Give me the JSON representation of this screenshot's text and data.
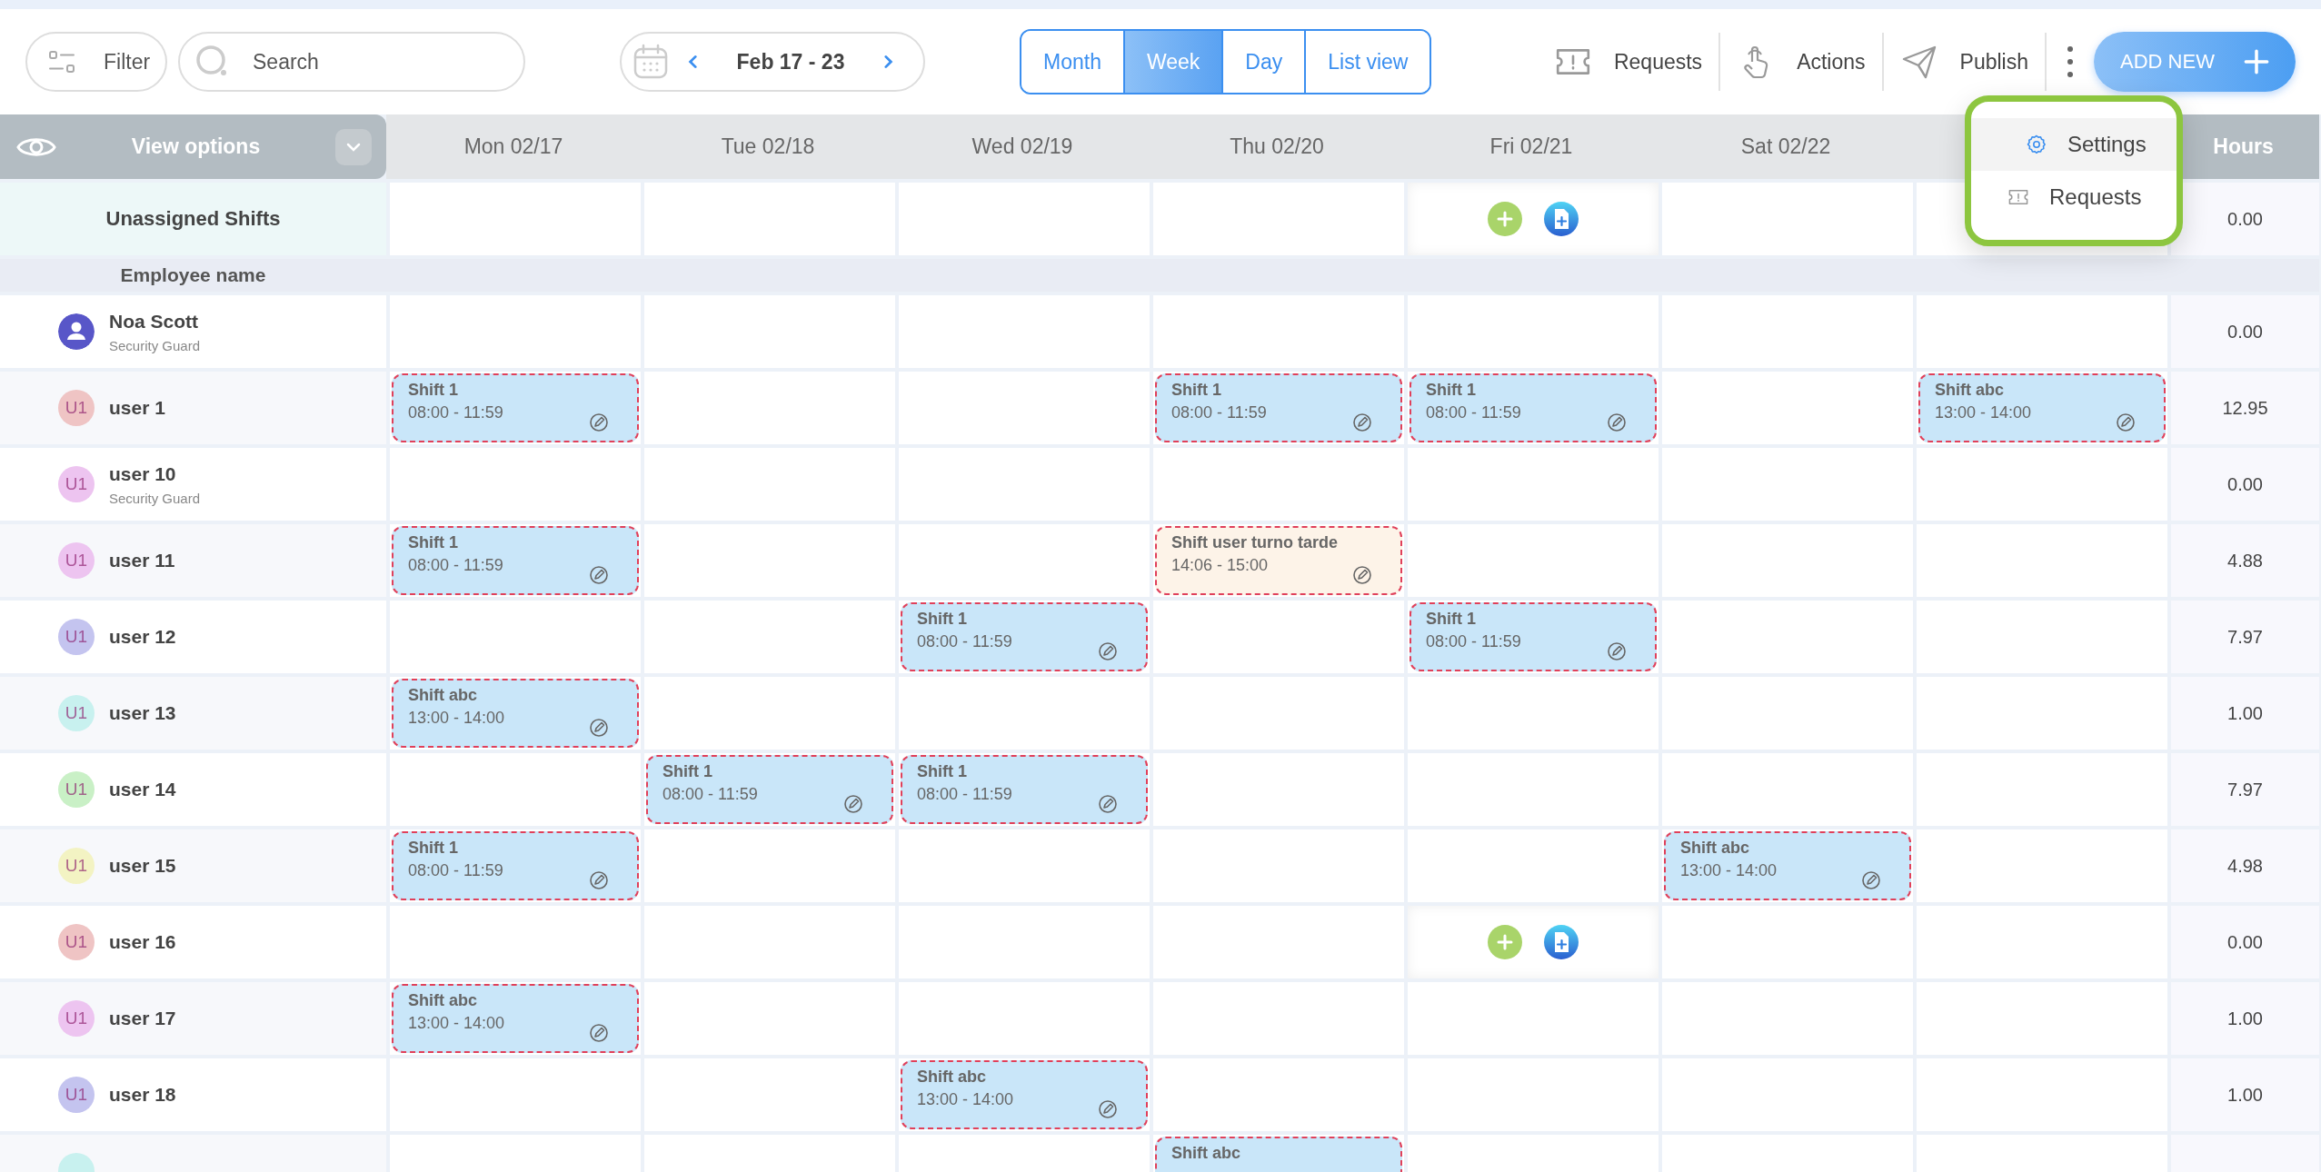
{
  "toolbar": {
    "filter": "Filter",
    "search": {
      "placeholder": "Search"
    },
    "date_range": "Feb 17 - 23",
    "views": [
      {
        "label": "Month",
        "selected": false
      },
      {
        "label": "Week",
        "selected": true
      },
      {
        "label": "Day",
        "selected": false
      },
      {
        "label": "List view",
        "selected": false
      }
    ],
    "actions": [
      {
        "label": "Requests",
        "kind": "ticket"
      },
      {
        "label": "Actions",
        "kind": "tap"
      },
      {
        "label": "Publish",
        "kind": "send"
      }
    ],
    "add_new": "ADD NEW"
  },
  "menu": {
    "items": [
      {
        "label": "Settings",
        "kind": "gear",
        "selected": true
      },
      {
        "label": "Requests",
        "kind": "ticket",
        "selected": false
      }
    ]
  },
  "grid": {
    "view_options": "View options",
    "days": [
      "Mon 02/17",
      "Tue 02/18",
      "Wed 02/19",
      "Thu 02/20",
      "Fri 02/21",
      "Sat 02/22"
    ],
    "hours_label": "Hours",
    "unassigned": {
      "label": "Unassigned Shifts",
      "hours": "0.00",
      "cells": [
        null,
        null,
        null,
        null,
        {
          "kind": "add-actions"
        },
        null,
        null
      ]
    },
    "employee_header": "Employee name",
    "rows": [
      {
        "name": "Noa Scott",
        "role": "Security Guard",
        "avatar": {
          "kind": "person",
          "color": "#5856c8"
        },
        "hours": "0.00",
        "cells": [
          null,
          null,
          null,
          null,
          null,
          null,
          null
        ]
      },
      {
        "name": "user 1",
        "avatar": {
          "kind": "initials",
          "initials": "U1",
          "color": "#efc4c4"
        },
        "hours": "12.95",
        "cells": [
          {
            "kind": "shift",
            "title": "Shift 1",
            "time": "08:00 - 11:59",
            "color": "#c9e6f9"
          },
          null,
          null,
          {
            "kind": "shift",
            "title": "Shift 1",
            "time": "08:00 - 11:59",
            "color": "#c9e6f9"
          },
          {
            "kind": "shift",
            "title": "Shift 1",
            "time": "08:00 - 11:59",
            "color": "#c9e6f9"
          },
          null,
          {
            "kind": "shift",
            "title": "Shift abc",
            "time": "13:00 - 14:00",
            "color": "#c9e6f9"
          }
        ]
      },
      {
        "name": "user 10",
        "role": "Security Guard",
        "avatar": {
          "kind": "initials",
          "initials": "U1",
          "color": "#edc4f0"
        },
        "hours": "0.00",
        "cells": [
          null,
          null,
          null,
          null,
          null,
          null,
          null
        ]
      },
      {
        "name": "user 11",
        "avatar": {
          "kind": "initials",
          "initials": "U1",
          "color": "#edc4f0"
        },
        "hours": "4.88",
        "cells": [
          {
            "kind": "shift",
            "title": "Shift 1",
            "time": "08:00 - 11:59",
            "color": "#c9e6f9"
          },
          null,
          null,
          {
            "kind": "shift",
            "title": "Shift user turno tarde",
            "time": "14:06 - 15:00",
            "color": "#fdf3e8"
          },
          null,
          null,
          null
        ]
      },
      {
        "name": "user 12",
        "avatar": {
          "kind": "initials",
          "initials": "U1",
          "color": "#c4c4ef"
        },
        "hours": "7.97",
        "cells": [
          null,
          null,
          {
            "kind": "shift",
            "title": "Shift 1",
            "time": "08:00 - 11:59",
            "color": "#c9e6f9"
          },
          null,
          {
            "kind": "shift",
            "title": "Shift 1",
            "time": "08:00 - 11:59",
            "color": "#c9e6f9"
          },
          null,
          null
        ]
      },
      {
        "name": "user 13",
        "avatar": {
          "kind": "initials",
          "initials": "U1",
          "color": "#c8f1ef"
        },
        "hours": "1.00",
        "cells": [
          {
            "kind": "shift",
            "title": "Shift abc",
            "time": "13:00 - 14:00",
            "color": "#c9e6f9"
          },
          null,
          null,
          null,
          null,
          null,
          null
        ]
      },
      {
        "name": "user 14",
        "avatar": {
          "kind": "initials",
          "initials": "U1",
          "color": "#c9f0c6"
        },
        "hours": "7.97",
        "cells": [
          null,
          {
            "kind": "shift",
            "title": "Shift 1",
            "time": "08:00 - 11:59",
            "color": "#c9e6f9"
          },
          {
            "kind": "shift",
            "title": "Shift 1",
            "time": "08:00 - 11:59",
            "color": "#c9e6f9"
          },
          null,
          null,
          null,
          null
        ]
      },
      {
        "name": "user 15",
        "avatar": {
          "kind": "initials",
          "initials": "U1",
          "color": "#f3f3c3"
        },
        "hours": "4.98",
        "cells": [
          {
            "kind": "shift",
            "title": "Shift 1",
            "time": "08:00 - 11:59",
            "color": "#c9e6f9"
          },
          null,
          null,
          null,
          null,
          {
            "kind": "shift",
            "title": "Shift abc",
            "time": "13:00 - 14:00",
            "color": "#c9e6f9"
          },
          null
        ]
      },
      {
        "name": "user 16",
        "avatar": {
          "kind": "initials",
          "initials": "U1",
          "color": "#efc4c4"
        },
        "hours": "0.00",
        "cells": [
          null,
          null,
          null,
          null,
          {
            "kind": "add-actions"
          },
          null,
          null
        ]
      },
      {
        "name": "user 17",
        "avatar": {
          "kind": "initials",
          "initials": "U1",
          "color": "#edc4f0"
        },
        "hours": "1.00",
        "cells": [
          {
            "kind": "shift",
            "title": "Shift abc",
            "time": "13:00 - 14:00",
            "color": "#c9e6f9"
          },
          null,
          null,
          null,
          null,
          null,
          null
        ]
      },
      {
        "name": "user 18",
        "avatar": {
          "kind": "initials",
          "initials": "U1",
          "color": "#c4c4ef"
        },
        "hours": "1.00",
        "cells": [
          null,
          null,
          {
            "kind": "shift",
            "title": "Shift abc",
            "time": "13:00 - 14:00",
            "color": "#c9e6f9"
          },
          null,
          null,
          null,
          null
        ]
      },
      {
        "avatar": {
          "kind": "blank",
          "color": "#c8f1ef"
        },
        "cells": [
          null,
          null,
          null,
          {
            "kind": "shift",
            "title": "Shift abc",
            "color": "#c9e6f9"
          },
          null,
          null,
          null
        ]
      }
    ]
  }
}
